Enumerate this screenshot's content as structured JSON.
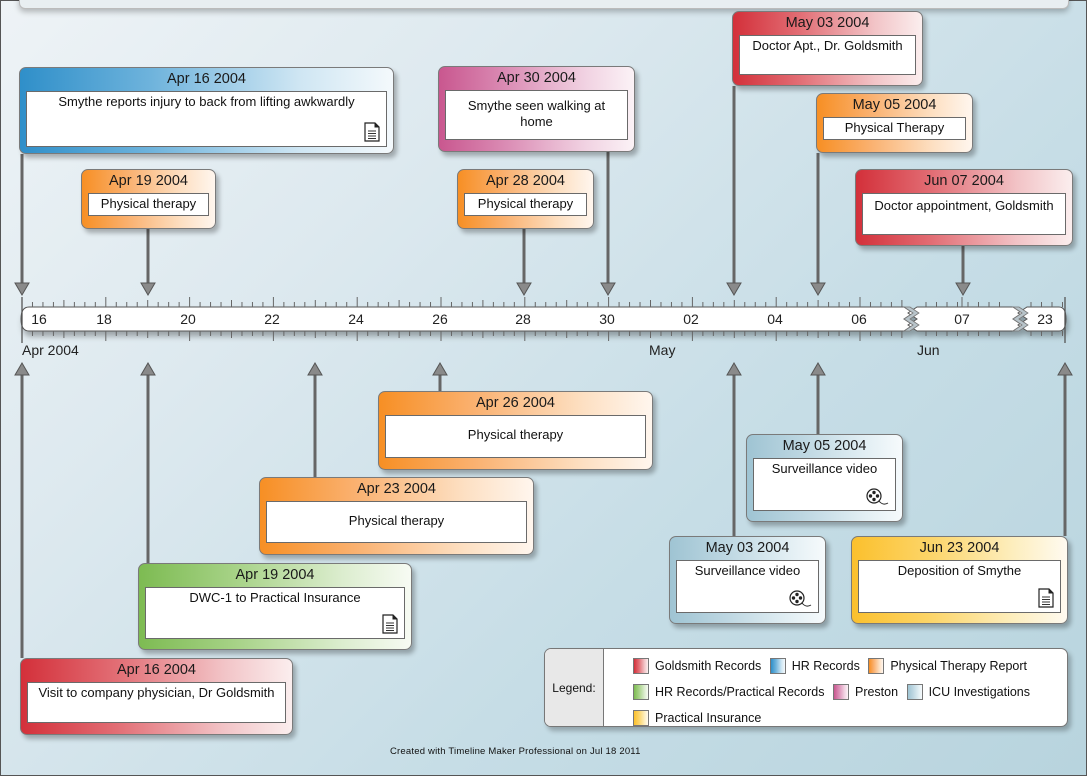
{
  "footer": "Created with Timeline Maker Professional on Jul 18 2011",
  "axis": {
    "ticks": [
      {
        "label": "16",
        "pos": 0
      },
      {
        "label": "18",
        "pos": 1
      },
      {
        "label": "20",
        "pos": 2
      },
      {
        "label": "22",
        "pos": 3
      },
      {
        "label": "24",
        "pos": 4
      },
      {
        "label": "26",
        "pos": 5
      },
      {
        "label": "28",
        "pos": 6
      },
      {
        "label": "30",
        "pos": 7
      },
      {
        "label": "02",
        "pos": 8
      },
      {
        "label": "04",
        "pos": 9
      },
      {
        "label": "06",
        "pos": 10
      },
      {
        "label": "07",
        "pos": 11
      },
      {
        "label": "23",
        "pos": 12
      }
    ],
    "months": [
      {
        "label": "Apr 2004"
      },
      {
        "label": "May"
      },
      {
        "label": "Jun"
      }
    ]
  },
  "legend": {
    "title": "Legend:",
    "items": [
      {
        "label": "Goldsmith Records",
        "category": "goldsmith",
        "color": "#d3303a"
      },
      {
        "label": "HR Records",
        "category": "hr",
        "color": "#2f8fc9"
      },
      {
        "label": "Physical Therapy Report",
        "category": "pt",
        "color": "#f78f24"
      },
      {
        "label": "HR Records/Practical Records",
        "category": "hrpr",
        "color": "#7dbb52"
      },
      {
        "label": "Preston",
        "category": "preston",
        "color": "#c9578f"
      },
      {
        "label": "ICU Investigations",
        "category": "icu",
        "color": "#9fc4d3"
      },
      {
        "label": "Practical Insurance",
        "category": "ins",
        "color": "#fbc02d"
      }
    ]
  },
  "events_above": [
    {
      "date": "Apr 16 2004",
      "text": "Smythe reports injury to back from lifting awkwardly",
      "category": "hr",
      "icon": "document-icon"
    },
    {
      "date": "Apr 19 2004",
      "text": "Physical therapy",
      "category": "pt",
      "icon": ""
    },
    {
      "date": "Apr 30 2004",
      "text": "Smythe seen walking at home",
      "category": "preston",
      "icon": ""
    },
    {
      "date": "Apr 28 2004",
      "text": "Physical therapy",
      "category": "pt",
      "icon": ""
    },
    {
      "date": "May 03 2004",
      "text": "Doctor Apt., Dr. Goldsmith",
      "category": "goldsmith",
      "icon": ""
    },
    {
      "date": "May 05 2004",
      "text": "Physical Therapy",
      "category": "pt",
      "icon": ""
    },
    {
      "date": "Jun 07 2004",
      "text": "Doctor appointment, Goldsmith",
      "category": "goldsmith",
      "icon": ""
    }
  ],
  "events_below": [
    {
      "date": "Apr 26 2004",
      "text": "Physical therapy",
      "category": "pt",
      "icon": ""
    },
    {
      "date": "Apr 23 2004",
      "text": "Physical therapy",
      "category": "pt",
      "icon": ""
    },
    {
      "date": "Apr 19 2004",
      "text": "DWC-1 to Practical Insurance",
      "category": "hrpr",
      "icon": "document-icon"
    },
    {
      "date": "Apr 16 2004",
      "text": "Visit to company physician, Dr Goldsmith",
      "category": "goldsmith",
      "icon": ""
    },
    {
      "date": "May 05 2004",
      "text": "Surveillance video",
      "category": "icu",
      "icon": "film-reel-icon"
    },
    {
      "date": "May 03 2004",
      "text": "Surveillance video",
      "category": "icu",
      "icon": "film-reel-icon"
    },
    {
      "date": "Jun 23 2004",
      "text": "Deposition of Smythe",
      "category": "ins",
      "icon": "document-icon"
    }
  ]
}
